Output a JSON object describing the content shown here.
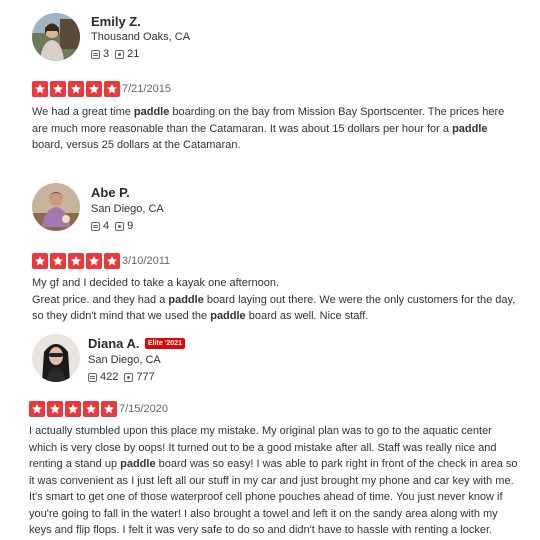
{
  "colors": {
    "star_red": "#e8393c",
    "elite_red": "#e00707",
    "text": "#333333"
  },
  "reviews": [
    {
      "name": "Emily Z.",
      "location": "Thousand Oaks, CA",
      "review_count": "3",
      "photo_count": "21",
      "rating": 5,
      "date": "7/21/2015",
      "lines": [
        [
          "We had a great time ",
          "paddle",
          " boarding on the bay from Mission Bay Sportscenter. The prices here"
        ],
        [
          "are much more reasonable than the Catamaran. It was about 15 dollars per hour for a ",
          "paddle",
          ""
        ],
        [
          "board, versus 25 dollars at the Catamaran.",
          "",
          ""
        ]
      ]
    },
    {
      "name": "Abe P.",
      "location": "San Diego, CA",
      "review_count": "4",
      "photo_count": "9",
      "rating": 5,
      "date": "3/10/2011",
      "lines": [
        [
          "My gf and I decided to take a kayak one afternoon.",
          "",
          ""
        ],
        [
          "Great price. and they had a ",
          "paddle",
          " board laying out there.  We were the only customers for the day,"
        ],
        [
          "so they didn't mind that we used the ",
          "paddle",
          " board as well.  Nice staff."
        ]
      ]
    },
    {
      "name": "Diana A.",
      "elite": "Elite '2021",
      "location": "San Diego, CA",
      "review_count": "422",
      "photo_count": "777",
      "rating": 5,
      "date": "7/15/2020",
      "lines": [
        [
          "I actually stumbled upon this place my mistake. My original plan was to go to the aquatic center",
          "",
          ""
        ],
        [
          "which is very close by oops! It turned out to be a good mistake after all. Staff was really nice and",
          "",
          ""
        ],
        [
          "renting a stand up ",
          "paddle",
          " board was so easy! I was able to park right in front of the check in area so"
        ],
        [
          "it was convenient as I just left all our stuff in my car and just brought my phone and car key with me.",
          "",
          ""
        ],
        [
          "It's smart to get one of those waterproof cell phone pouches ahead of time. You just never know if",
          "",
          ""
        ],
        [
          "you're going to fall in the water! I also brought a towel and left it on the sandy area along with my",
          "",
          ""
        ],
        [
          "keys and flip flops. I felt it was very safe to do so and didn't have to hassle with renting a locker.",
          "",
          ""
        ]
      ]
    }
  ]
}
